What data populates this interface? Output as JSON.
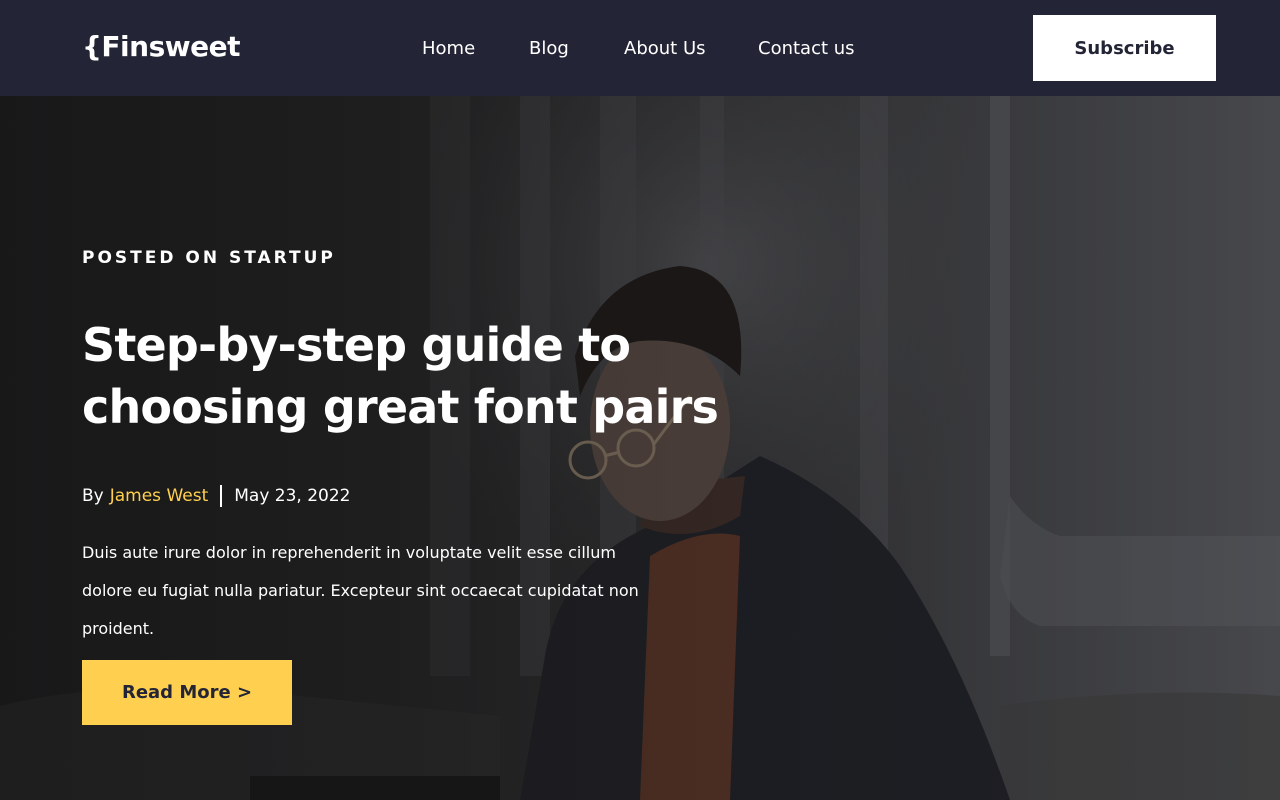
{
  "navbar": {
    "logo": "{Finsweet",
    "links": [
      {
        "label": "Home"
      },
      {
        "label": "Blog"
      },
      {
        "label": "About Us"
      },
      {
        "label": "Contact us"
      }
    ],
    "subscribe_label": "Subscribe"
  },
  "hero": {
    "posted_on": "POSTED ON STARTUP",
    "title": "Step-by-step guide to choosing great font pairs",
    "by_label": "By",
    "author": "James West",
    "date": "May 23, 2022",
    "excerpt": "Duis aute irure dolor in reprehenderit in voluptate velit esse cillum dolore eu fugiat nulla pariatur. Excepteur sint occaecat cupidatat non proident.",
    "read_more_label": "Read More >"
  },
  "colors": {
    "navbar_bg": "#232536",
    "accent": "#FFD050",
    "text": "#FFFFFF"
  }
}
